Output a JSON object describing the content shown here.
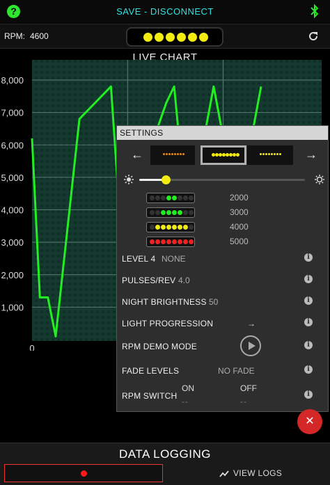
{
  "topbar": {
    "title": "SAVE - DISCONNECT",
    "help_icon": "?"
  },
  "rpmbar": {
    "label": "RPM:",
    "value": "4600",
    "led_color": "#f3ec12",
    "led_count": 6
  },
  "chart": {
    "title": "LIVE CHART"
  },
  "chart_data": {
    "type": "line",
    "title": "LIVE CHART",
    "y_tick_labels": [
      "8,000",
      "7,000",
      "6,000",
      "5,000",
      "4,000",
      "3,000",
      "2,000",
      "1,000"
    ],
    "x_tick_labels": [
      "0"
    ],
    "ylim": [
      0,
      8000
    ],
    "grid": true,
    "series": [
      {
        "color": "#22ee22",
        "points": [
          [
            0,
            6200
          ],
          [
            1,
            1300
          ],
          [
            2,
            1300
          ],
          [
            3,
            100
          ],
          [
            6,
            6800
          ],
          [
            10,
            7800
          ],
          [
            11,
            4200
          ],
          [
            12,
            100
          ],
          [
            14,
            3700
          ],
          [
            16,
            6600
          ],
          [
            17,
            7300
          ],
          [
            18,
            7800
          ],
          [
            19,
            5200
          ],
          [
            21,
            5200
          ],
          [
            23,
            7800
          ],
          [
            25,
            5200
          ],
          [
            27,
            5200
          ],
          [
            29,
            7800
          ]
        ]
      }
    ]
  },
  "settings": {
    "title": "SETTINGS",
    "presets": [
      {
        "color": "#e08a1e",
        "selected": false
      },
      {
        "color": "#f3ec12",
        "selected": true
      },
      {
        "color": "#f3ec12",
        "selected": false
      }
    ],
    "brightness": 0.16,
    "levels": [
      {
        "value": "2000",
        "colors": [
          "#333",
          "#333",
          "#333",
          "#22ee22",
          "#22ee22",
          "#333",
          "#333",
          "#333"
        ]
      },
      {
        "value": "3000",
        "colors": [
          "#333",
          "#333",
          "#22ee22",
          "#22ee22",
          "#22ee22",
          "#22ee22",
          "#333",
          "#333"
        ]
      },
      {
        "value": "4000",
        "colors": [
          "#333",
          "#f3ec12",
          "#f3ec12",
          "#f3ec12",
          "#f3ec12",
          "#f3ec12",
          "#f3ec12",
          "#333"
        ]
      },
      {
        "value": "5000",
        "colors": [
          "#ee2222",
          "#ee2222",
          "#ee2222",
          "#ee2222",
          "#ee2222",
          "#ee2222",
          "#ee2222",
          "#ee2222"
        ]
      }
    ],
    "rows": {
      "level4": {
        "label": "LEVEL 4",
        "value": "NONE"
      },
      "pulses": {
        "label": "PULSES/REV",
        "value": "4.0"
      },
      "night": {
        "label": "NIGHT BRIGHTNESS",
        "value": "50"
      },
      "progression": {
        "label": "LIGHT PROGRESSION",
        "value": "→"
      },
      "demo": {
        "label": "RPM DEMO MODE"
      },
      "fade": {
        "label": "FADE LEVELS",
        "value": "NO FADE"
      },
      "switch": {
        "label": "RPM SWITCH",
        "on_label": "ON",
        "on_value": "--",
        "off_label": "OFF",
        "off_value": "--"
      }
    },
    "info_glyph": "i"
  },
  "close_glyph": "✕",
  "logging": {
    "title": "DATA LOGGING",
    "view_logs": "VIEW LOGS"
  }
}
